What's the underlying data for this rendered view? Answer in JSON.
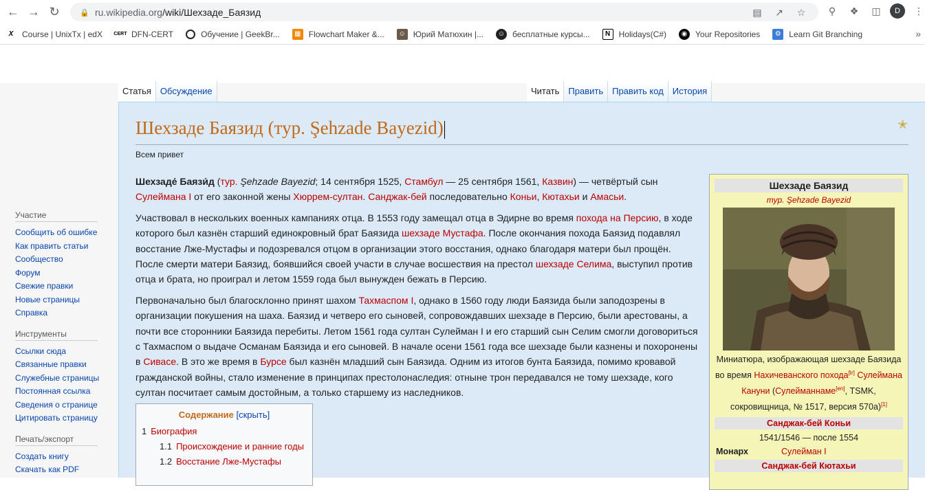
{
  "browser": {
    "url_host": "ru.wikipedia.org",
    "url_path": "/wiki/Шехзаде_Баязид",
    "profile_letter": "D",
    "bookmarks": [
      {
        "label": "Course | UnixTx | edX",
        "icon": "edx-icon"
      },
      {
        "label": "DFN-CERT",
        "icon": "cert-icon"
      },
      {
        "label": "Обучение | GeekBr...",
        "icon": "geekbrains-icon"
      },
      {
        "label": "Flowchart Maker &...",
        "icon": "flowchart-icon"
      },
      {
        "label": "Юрий Матюхин |...",
        "icon": "avatar-icon"
      },
      {
        "label": "бесплатные курсы...",
        "icon": "courses-icon"
      },
      {
        "label": "Holidays(C#)",
        "icon": "notion-icon"
      },
      {
        "label": "Your Repositories",
        "icon": "github-icon"
      },
      {
        "label": "Learn Git Branching",
        "icon": "git-icon"
      }
    ]
  },
  "wiki": {
    "tabs_left": [
      "Статья",
      "Обсуждение"
    ],
    "tabs_right": [
      "Читать",
      "Править",
      "Править код",
      "История"
    ],
    "sidebar": {
      "participation_heading": "Участие",
      "participation": [
        "Сообщить об ошибке",
        "Как править статьи",
        "Сообщество",
        "Форум",
        "Свежие правки",
        "Новые страницы",
        "Справка"
      ],
      "tools_heading": "Инструменты",
      "tools": [
        "Ссылки сюда",
        "Связанные правки",
        "Служебные страницы",
        "Постоянная ссылка",
        "Сведения о странице",
        "Цитировать страницу"
      ],
      "print_heading": "Печать/экспорт",
      "print": [
        "Создать книгу",
        "Скачать как PDF"
      ]
    },
    "title": "Шехзаде Баязид (тур. Şehzade Bayezid)",
    "subtitle": "Всем привет",
    "p1": {
      "name": "Шехзаде́ Баязи́д",
      "t1": " (",
      "tur": "тур.",
      "t2": " ",
      "orig": "Şehzade Bayezid",
      "t3": "; 14 сентября 1525, ",
      "istanbul": "Стамбул",
      "t4": " — 25 сентября 1561, ",
      "kazvin": "Казвин",
      "t5": ") — четвёртый сын ",
      "suleiman": "Сулеймана I",
      "t6": " от его законной жены ",
      "hurrem": "Хюррем-султан",
      "t7": ". ",
      "sanjak": "Санджак-бей",
      "t8": " последовательно ",
      "konya": "Коньи",
      "t9": ", ",
      "kutahya": "Кютахьи",
      "t10": " и ",
      "amasya": "Амасьи",
      "t11": "."
    },
    "p2": {
      "t1": "Участвовал в нескольких военных кампаниях отца. В 1553 году замещал отца в Эдирне во время ",
      "campaign": "похода на Персию",
      "t2": ", в ходе которого был казнён старший единокровный брат Баязида ",
      "mustafa": "шехзаде Мустафа",
      "t3": ". После окончания похода Баязид подавлял восстание Лже-Мустафы и подозревался отцом в организации этого восстания, однако благодаря матери был прощён. После смерти матери Баязид, боявшийся своей участи в случае восшествия на престол ",
      "selim": "шехзаде Селима",
      "t4": ", выступил против отца и брата, но проиграл и летом 1559 года был вынужден бежать в Персию."
    },
    "p3": {
      "t1": "Первоначально был благосклонно принят шахом ",
      "tahmasp": "Тахмаспом I",
      "t2": ", однако в 1560 году люди Баязида были заподозрены в организации покушения на шаха. Баязид и четверо его сыновей, сопровождавших шехзаде в Персию, были арестованы, а почти все сторонники Баязида перебиты. Летом 1561 года султан Сулейман I и его старший сын Селим смогли договориться с Тахмаспом о выдаче Османам Баязида и его сыновей. В начале осени 1561 года все шехзаде были казнены и похоронены в ",
      "sivas": "Сивасе",
      "t3": ". В это же время в ",
      "bursa": "Бурсе",
      "t4": " был казнён младший сын Баязида. Одним из итогов бунта Баязида, помимо кровавой гражданской войны, стало изменение в принципах престолонаследия: отныне трон передавался не тому шехзаде, кого султан посчитает самым достойным, а только старшему из наследников."
    },
    "toc": {
      "title": "Содержание",
      "toggle": "[скрыть]",
      "items": [
        {
          "num": "1",
          "label": "Биография"
        },
        {
          "num": "1.1",
          "label": "Происхождение и ранние годы"
        },
        {
          "num": "1.2",
          "label": "Восстание Лже-Мустафы"
        }
      ]
    },
    "infobox": {
      "title": "Шехзаде Баязид",
      "original": "тур. Şehzade Bayezid",
      "caption_1": "Миниатюра, изображающая шехзаде Баязида во время ",
      "caption_link": "Нахичеванского похода",
      "caption_sup": "[tr]",
      "caption_2": " ",
      "caption_link2": "Сулеймана Кануни",
      "caption_3": " (",
      "caption_link3": "Сулейманнаме",
      "caption_sup2": "[en]",
      "caption_4": ", TSMK, сокровищница, № 1517, версия 570a)",
      "caption_sup3": "[1]",
      "section1": "Санджак-бей Коньи",
      "period1": "1541/1546 — после 1554",
      "monarch_label": "Монарх",
      "monarch_value": "Сулейман I",
      "section2": "Санджак-бей Кютахьи"
    }
  }
}
